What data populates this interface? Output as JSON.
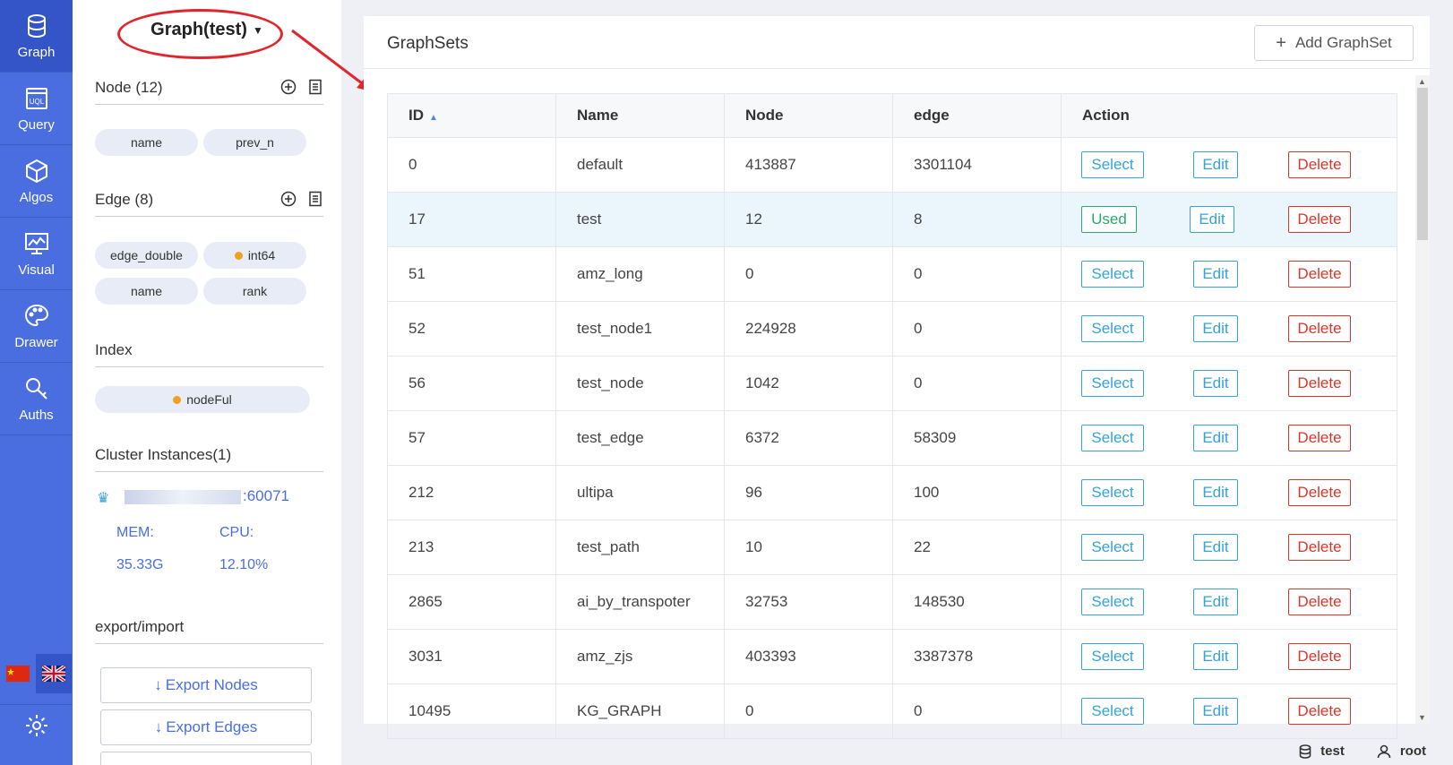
{
  "nav": {
    "items": [
      {
        "label": "Graph",
        "icon": "database-icon"
      },
      {
        "label": "Query",
        "icon": "uql-icon"
      },
      {
        "label": "Algos",
        "icon": "cube-icon"
      },
      {
        "label": "Visual",
        "icon": "monitor-chart-icon"
      },
      {
        "label": "Drawer",
        "icon": "palette-icon"
      },
      {
        "label": "Auths",
        "icon": "key-icon"
      }
    ]
  },
  "panel": {
    "graph_title": "Graph(test)",
    "node_header": "Node (12)",
    "node_props": [
      "name",
      "prev_n"
    ],
    "edge_header": "Edge (8)",
    "edge_props": [
      "edge_double",
      "int64",
      "name",
      "rank"
    ],
    "index_header": "Index",
    "index_item": "nodeFul",
    "cluster_header": "Cluster Instances(1)",
    "instance_port": ":60071",
    "mem_label": "MEM:",
    "cpu_label": "CPU:",
    "mem_value": "35.33G",
    "cpu_value": "12.10%",
    "export_header": "export/import",
    "export_nodes": "Export Nodes",
    "export_edges": "Export Edges"
  },
  "main": {
    "title": "GraphSets",
    "add_button": "Add GraphSet",
    "columns": [
      "ID",
      "Name",
      "Node",
      "edge",
      "Action"
    ],
    "rows": [
      {
        "id": "0",
        "name": "default",
        "node": "413887",
        "edge": "3301104",
        "used": false
      },
      {
        "id": "17",
        "name": "test",
        "node": "12",
        "edge": "8",
        "used": true
      },
      {
        "id": "51",
        "name": "amz_long",
        "node": "0",
        "edge": "0",
        "used": false
      },
      {
        "id": "52",
        "name": "test_node1",
        "node": "224928",
        "edge": "0",
        "used": false
      },
      {
        "id": "56",
        "name": "test_node",
        "node": "1042",
        "edge": "0",
        "used": false
      },
      {
        "id": "57",
        "name": "test_edge",
        "node": "6372",
        "edge": "58309",
        "used": false
      },
      {
        "id": "212",
        "name": "ultipa",
        "node": "96",
        "edge": "100",
        "used": false
      },
      {
        "id": "213",
        "name": "test_path",
        "node": "10",
        "edge": "22",
        "used": false
      },
      {
        "id": "2865",
        "name": "ai_by_transpoter",
        "node": "32753",
        "edge": "148530",
        "used": false
      },
      {
        "id": "3031",
        "name": "amz_zjs",
        "node": "403393",
        "edge": "3387378",
        "used": false
      },
      {
        "id": "10495",
        "name": "KG_GRAPH",
        "node": "0",
        "edge": "0",
        "used": false
      }
    ],
    "select_label": "Select",
    "used_label": "Used",
    "edit_label": "Edit",
    "delete_label": "Delete"
  },
  "footer": {
    "graph": "test",
    "user": "root"
  },
  "colors": {
    "nav": "#4a6ee0",
    "accent": "#35a3d6",
    "danger": "#d9362b",
    "success": "#2aa86a",
    "annotation": "#e0262c"
  }
}
